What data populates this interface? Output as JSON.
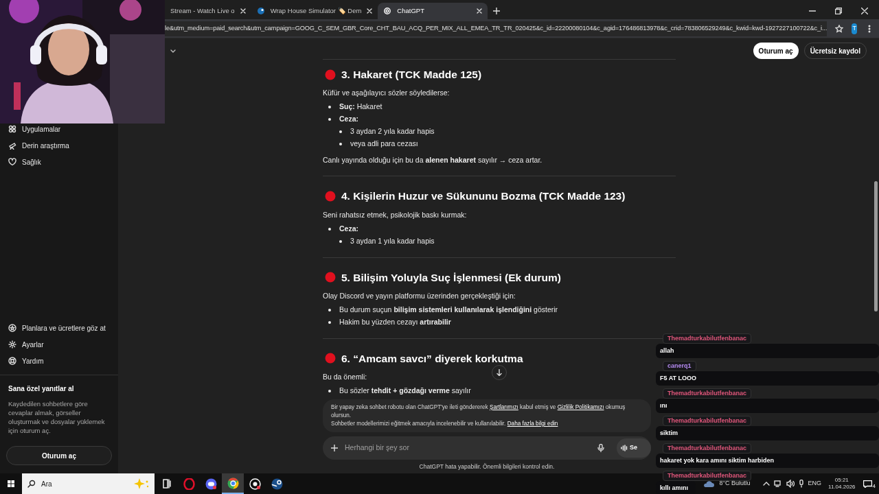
{
  "browser": {
    "tabs": [
      {
        "title": "Stream - Watch Live o",
        "selected": false
      },
      {
        "title": "Wrap House Simulator 🏷️ Dem",
        "selected": false
      },
      {
        "title": "ChatGPT",
        "selected": true
      }
    ],
    "url": "le&utm_medium=paid_search&utm_campaign=GOOG_C_SEM_GBR_Core_CHT_BAU_ACQ_PER_MIX_ALL_EMEA_TR_TR_020425&c_id=22200080104&c_agid=176486813978&c_crid=783806529249&c_kwid=kwd-1927227100722&c_i...",
    "profile": "T"
  },
  "header": {
    "buttons": [
      {
        "label": "Oturum aç",
        "kind": "primary"
      },
      {
        "label": "Ücretsiz kaydol",
        "kind": "secondary"
      }
    ]
  },
  "sidebar": {
    "top_items": [
      {
        "label": "Uygulamalar"
      },
      {
        "label": "Derin araştırma"
      },
      {
        "label": "Sağlık"
      }
    ],
    "bottom_items": [
      {
        "label": "Planlara ve ücretlere göz at"
      },
      {
        "label": "Ayarlar"
      },
      {
        "label": "Yardım"
      }
    ],
    "promo": {
      "title": "Sana özel yanıtlar al",
      "text": "Kaydedilen sohbetlere göre cevaplar almak, görseller oluşturmak ve dosyalar yüklemek için oturum aç.",
      "button": "Oturum aç"
    }
  },
  "sections": [
    {
      "heading": "3. Hakaret (TCK Madde 125)",
      "intro": "Küfür ve aşağılayıcı sözler söyledilerse:",
      "bullets": [
        {
          "text": "**Suç:** Hakaret"
        },
        {
          "text": "**Ceza:**",
          "children": [
            {
              "text": "3 aydan 2 yıla kadar hapis"
            },
            {
              "text": "veya adli para cezası"
            }
          ]
        }
      ],
      "note": "Canlı yayında olduğu için bu da **alenen hakaret** sayılır → ceza artar."
    },
    {
      "heading": "4. Kişilerin Huzur ve Sükununu Bozma (TCK Madde 123)",
      "intro": "Seni rahatsız etmek, psikolojik baskı kurmak:",
      "bullets": [
        {
          "text": "**Ceza:**",
          "children": [
            {
              "text": "3 aydan 1 yıla kadar hapis"
            }
          ]
        }
      ]
    },
    {
      "heading": "5. Bilişim Yoluyla Suç İşlenmesi (Ek durum)",
      "intro": "Olay Discord ve yayın platformu üzerinden gerçekleştiği için:",
      "bullets": [
        {
          "text": "Bu durum suçun **bilişim sistemleri kullanılarak işlendiğini** gösterir"
        },
        {
          "text": "Hakim bu yüzden cezayı **artırabilir**"
        }
      ]
    },
    {
      "heading": "6. “Amcam savcı” diyerek korkutma",
      "intro": "Bu da önemli:",
      "bullets": [
        {
          "text": "Bu sözler **tehdit + gözdağı verme** sayılır"
        }
      ]
    }
  ],
  "disclaimer": {
    "lines": [
      [
        {
          "kind": "text",
          "text": "Bir yapay zeka sohbet robotu olan ChatGPT'ye ileti göndererek"
        },
        {
          "kind": "link",
          "text": "Şartlarımızı"
        },
        {
          "kind": "text",
          "text": "kabul etmiş ve"
        },
        {
          "kind": "link",
          "text": "Gizlilik Politikamızı"
        },
        {
          "kind": "text",
          "text": "okumuş olursun."
        }
      ],
      [
        {
          "kind": "text",
          "text": "Sohbetler modellerimizi eğitmek amacıyla incelenebilir ve kullanılabilir."
        },
        {
          "kind": "link",
          "text": "Daha fazla bilgi edin"
        }
      ]
    ]
  },
  "composer": {
    "placeholder": "Herhangi bir şey sor",
    "voice_button": "Se"
  },
  "footer": "ChatGPT hata yapabilir. Önemli bilgileri kontrol edin.",
  "chat": [
    {
      "user": "Themadturkabilutfenbanac",
      "color": "#e0567a",
      "text": "allah"
    },
    {
      "user": "canerq1",
      "color": "#b48af0",
      "text": "F5 AT LOOO"
    },
    {
      "user": "Themadturkabilutfenbanac",
      "color": "#e0567a",
      "text": "ını"
    },
    {
      "user": "Themadturkabilutfenbanac",
      "color": "#e0567a",
      "text": "siktim"
    },
    {
      "user": "Themadturkabilutfenbanac",
      "color": "#e0567a",
      "text": "hakaret yok kara amını siktim harbiden"
    },
    {
      "user": "Themadturkabilutfenbanac",
      "color": "#e0567a",
      "text": "kıllı amını"
    }
  ],
  "taskbar": {
    "search_placeholder": "Ara",
    "apps": [
      {
        "selected": false
      },
      {
        "selected": false
      },
      {
        "selected": false
      },
      {
        "selected": true
      },
      {
        "selected": false
      },
      {
        "selected": false
      }
    ],
    "weather": "8°C Bulutlu",
    "language": "ENG",
    "time": "05:21",
    "date": "11.04.2026",
    "notifications": "4"
  }
}
